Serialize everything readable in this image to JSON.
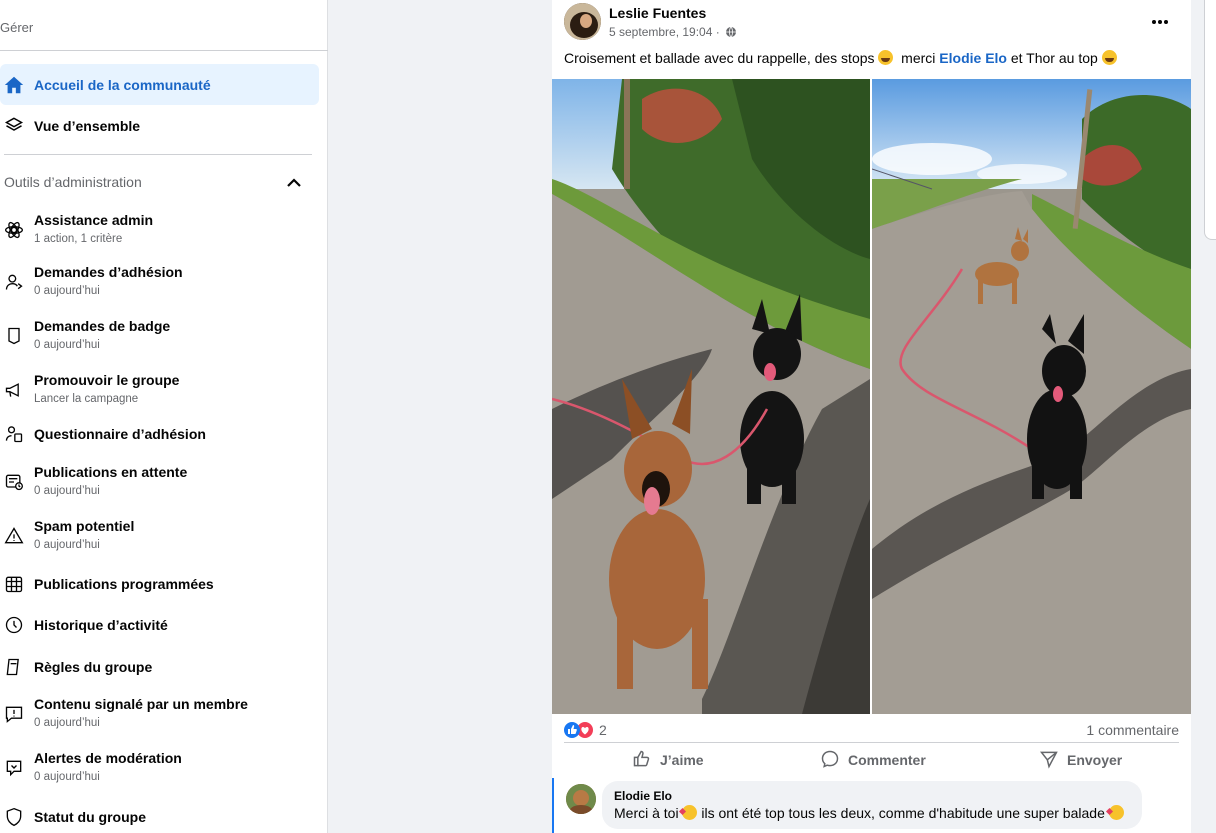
{
  "sidebar": {
    "header": "Gérer",
    "items_top": [
      {
        "label": "Accueil de la communauté",
        "icon": "home-icon"
      },
      {
        "label": "Vue d’ensemble",
        "icon": "layers-icon"
      }
    ],
    "section_title": "Outils d’administration",
    "tools": [
      {
        "label": "Assistance admin",
        "sub": "1 action, 1 critère",
        "icon": "admin-assist-icon"
      },
      {
        "label": "Demandes d’adhésion",
        "sub": "0 aujourd’hui",
        "icon": "member-request-icon"
      },
      {
        "label": "Demandes de badge",
        "sub": "0 aujourd’hui",
        "icon": "badge-icon"
      },
      {
        "label": "Promouvoir le groupe",
        "sub": "Lancer la campagne",
        "icon": "megaphone-icon"
      },
      {
        "label": "Questionnaire d’adhésion",
        "sub": "",
        "icon": "questionnaire-icon"
      },
      {
        "label": "Publications en attente",
        "sub": "0 aujourd’hui",
        "icon": "pending-posts-icon"
      },
      {
        "label": "Spam potentiel",
        "sub": "0 aujourd’hui",
        "icon": "warning-icon"
      },
      {
        "label": "Publications programmées",
        "sub": "",
        "icon": "calendar-icon"
      },
      {
        "label": "Historique d’activité",
        "sub": "",
        "icon": "clock-icon"
      },
      {
        "label": "Règles du groupe",
        "sub": "",
        "icon": "rules-icon"
      },
      {
        "label": "Contenu signalé par un membre",
        "sub": "0 aujourd’hui",
        "icon": "report-icon"
      },
      {
        "label": "Alertes de modération",
        "sub": "0 aujourd’hui",
        "icon": "moderation-alert-icon"
      },
      {
        "label": "Statut du groupe",
        "sub": "",
        "icon": "shield-icon"
      }
    ]
  },
  "post": {
    "author": "Leslie Fuentes",
    "date": "5 septembre, 19:04 ·",
    "text_before": "Croisement et ballade avec du rappelle, des stops ",
    "text_merci": "  merci ",
    "mention": "Elodie Elo",
    "text_after": " et Thor au top ",
    "reaction_count": "2",
    "comments_count": "1 commentaire",
    "actions": {
      "like": "J’aime",
      "comment": "Commenter",
      "send": "Envoyer"
    },
    "comment": {
      "author": "Elodie Elo",
      "text_before": "Merci à toi ",
      "text_after": " ils ont été top tous les deux, comme d'habitude une super balade "
    }
  },
  "colors": {
    "accent": "#1a66c6",
    "like_blue": "#1877f2",
    "love_red": "#f33e58",
    "active_bg": "#e7f3ff"
  }
}
